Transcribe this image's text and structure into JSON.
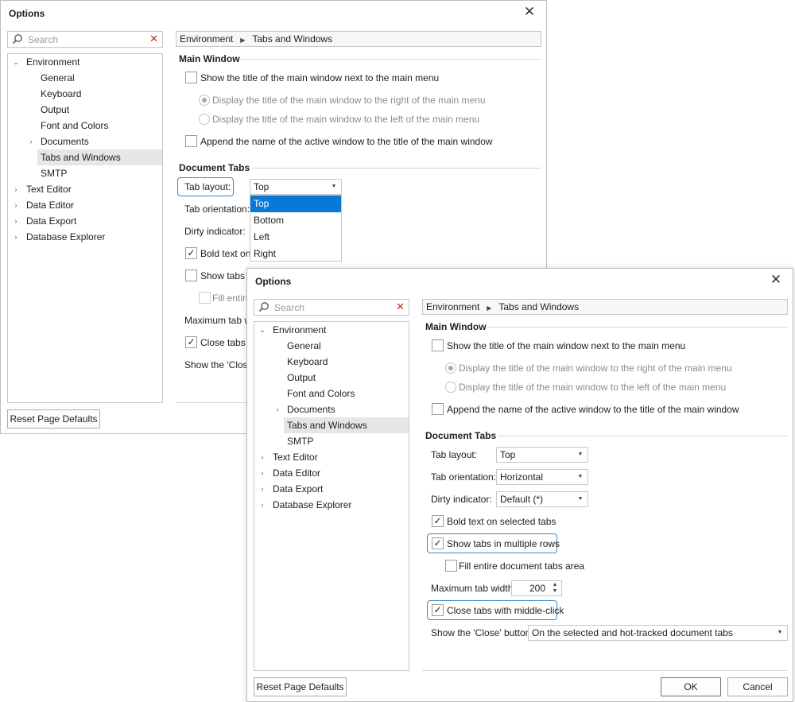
{
  "dialog": {
    "title": "Options",
    "search_placeholder": "Search",
    "tree": [
      {
        "label": "Environment",
        "expanded": true
      },
      {
        "label": "General"
      },
      {
        "label": "Keyboard"
      },
      {
        "label": "Output"
      },
      {
        "label": "Font and Colors"
      },
      {
        "label": "Documents",
        "collapsed": true
      },
      {
        "label": "Tabs and Windows",
        "selected": true
      },
      {
        "label": "SMTP"
      },
      {
        "label": "Text Editor"
      },
      {
        "label": "Data Editor"
      },
      {
        "label": "Data Export"
      },
      {
        "label": "Database Explorer"
      }
    ],
    "breadcrumb": [
      "Environment",
      "Tabs and Windows"
    ],
    "reset_label": "Reset Page Defaults",
    "ok_label": "OK",
    "cancel_label": "Cancel"
  },
  "main_window": {
    "heading": "Main Window",
    "show_title": "Show the title of the main window next to the main menu",
    "display_right": "Display the title of the main window to the right of the main menu",
    "display_left": "Display the title of the main window to the left of the main menu",
    "append_name": "Append the name of the active window to the title of the main window"
  },
  "document_tabs": {
    "heading": "Document Tabs",
    "tab_layout_label": "Tab layout:",
    "tab_layout_value": "Top",
    "tab_layout_options": [
      "Top",
      "Bottom",
      "Left",
      "Right"
    ],
    "tab_orientation_label": "Tab orientation:",
    "tab_orientation_value": "Horizontal",
    "dirty_label": "Dirty indicator:",
    "dirty_value": "Default (*)",
    "bold_text": "Bold text on selected tabs",
    "bold_text_checked": true,
    "multiple_rows": "Show tabs in multiple rows",
    "multiple_rows_checked": true,
    "fill_area": "Fill entire document tabs area",
    "max_width_label": "Maximum tab width:",
    "max_width_value": "200",
    "middle_click": "Close tabs with middle-click",
    "middle_click_checked": true,
    "close_button_label": "Show the 'Close' button:",
    "close_button_value": "On the selected and hot-tracked document tabs"
  },
  "back_partial": {
    "bold_text": "Bold text on s",
    "multiple_rows": "Show tabs in",
    "fill_area": "Fill entire",
    "max_width_label": "Maximum tab wid",
    "middle_click": "Close tabs w",
    "close_button_label": "Show the 'Close'"
  },
  "colors": {
    "accent": "#0a78d7",
    "focus_ring": "#3b87c4",
    "clear_icon": "#c42b1c"
  }
}
